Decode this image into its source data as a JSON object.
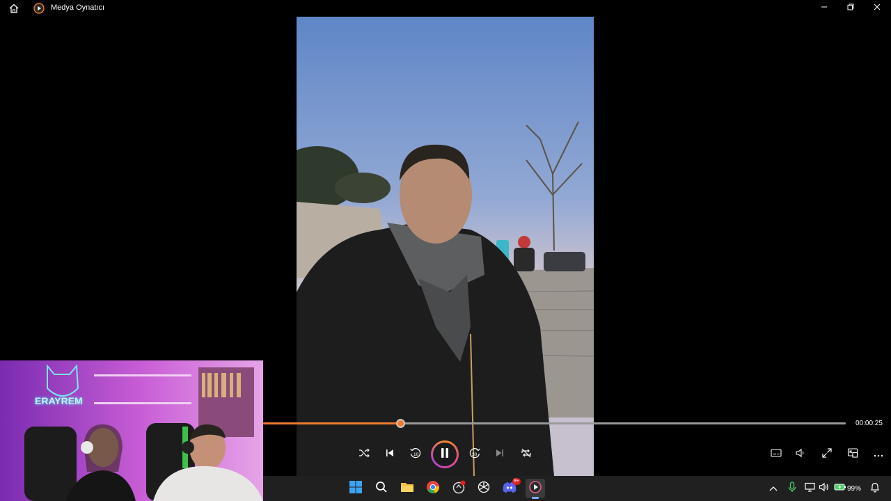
{
  "titlebar": {
    "title": "Medya Oynatıcı"
  },
  "icons": {
    "home": "home-icon",
    "app": "media-player-icon",
    "minimize": "minimize-icon",
    "restore": "restore-icon",
    "close": "close-icon"
  },
  "player": {
    "time_elapsed": "00:00:25",
    "progress_fraction": 0.235,
    "accent_color": "#f07b2b",
    "controls": [
      "shuffle",
      "previous",
      "skip-back-10",
      "pause",
      "skip-forward-30",
      "next",
      "repeat"
    ],
    "right_controls": [
      "captions",
      "volume",
      "fullscreen",
      "mini-player",
      "more"
    ]
  },
  "webcam": {
    "logo_text": "ERAYREM"
  },
  "taskbar": {
    "apps": [
      "start",
      "search",
      "file-explorer",
      "chrome",
      "app-red-dot",
      "chatgpt",
      "discord",
      "media-player"
    ],
    "discord_badge": "9+",
    "battery": "99%"
  }
}
